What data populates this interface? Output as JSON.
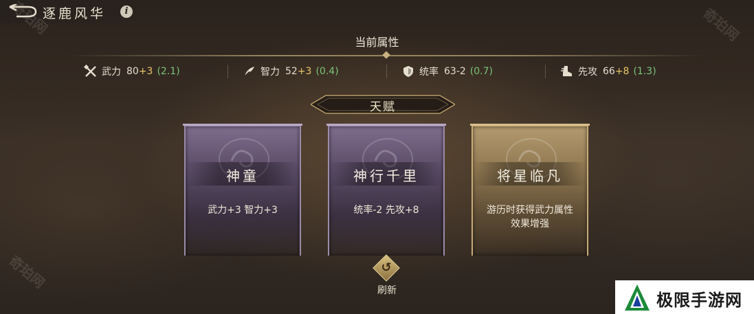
{
  "header": {
    "title": "逐鹿风华",
    "back_icon": "back-arrow-icon",
    "info_label": "i"
  },
  "attributes": {
    "title": "当前属性",
    "items": [
      {
        "name": "武力",
        "base": "80",
        "bonus": "+3",
        "rate": "(2.1)",
        "icon": "crossed-swords-icon"
      },
      {
        "name": "智力",
        "base": "52",
        "bonus": "+3",
        "rate": "(0.4)",
        "icon": "feather-icon"
      },
      {
        "name": "统率",
        "base": "63",
        "bonus": "-2",
        "rate": "(0.7)",
        "icon": "shield-icon"
      },
      {
        "name": "先攻",
        "base": "66",
        "bonus": "+8",
        "rate": "(1.3)",
        "icon": "boot-icon"
      }
    ]
  },
  "talent": {
    "title": "天赋",
    "cards": [
      {
        "name": "神童",
        "desc": "武力+3  智力+3",
        "rarity": "purple"
      },
      {
        "name": "神行千里",
        "desc": "统率-2  先攻+8",
        "rarity": "purple"
      },
      {
        "name": "将星临凡",
        "desc": "游历时获得武力属性效果增强",
        "rarity": "gold"
      }
    ]
  },
  "refresh": {
    "label": "刷新"
  },
  "watermarks": {
    "site": "奇珀网"
  },
  "corner_logo": {
    "text": "极限手游网"
  },
  "colors": {
    "bonus": "#e8c66a",
    "rate": "#7cc47a",
    "purple_card": "#5a4b66",
    "gold_card": "#8e7650"
  }
}
